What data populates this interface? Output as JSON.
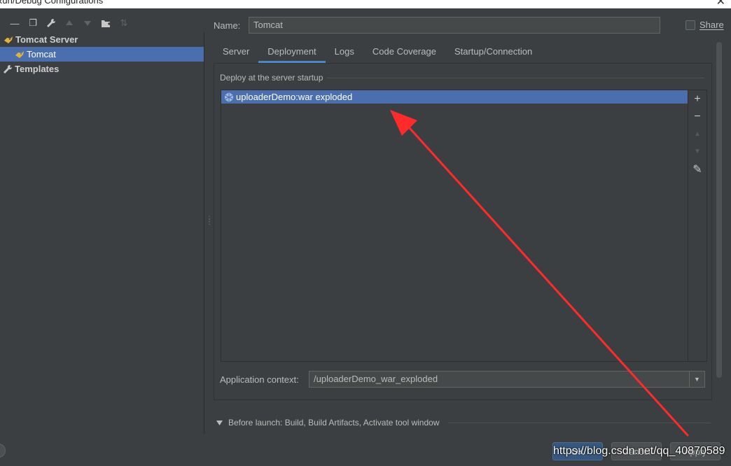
{
  "window": {
    "title": "Run/Debug Configurations",
    "close_glyph": "✕"
  },
  "toolbar": {
    "buttons": [
      {
        "name": "remove-icon",
        "glyph": "—",
        "enabled": true
      },
      {
        "name": "copy-icon",
        "glyph": "❐",
        "enabled": true
      },
      {
        "name": "wrench-icon",
        "glyph": "🔧",
        "enabled": true
      },
      {
        "name": "move-up-icon",
        "glyph": "▲",
        "enabled": false
      },
      {
        "name": "move-down-icon",
        "glyph": "▼",
        "enabled": false
      },
      {
        "name": "folder-add-icon",
        "glyph": "📁",
        "enabled": true
      },
      {
        "name": "sort-icon",
        "glyph": "⇅",
        "enabled": false
      }
    ]
  },
  "tree": {
    "items": [
      {
        "label": "Tomcat Server",
        "level": 0,
        "bold": true,
        "selected": false,
        "icon": "tomcat-icon"
      },
      {
        "label": "Tomcat",
        "level": 1,
        "bold": false,
        "selected": true,
        "icon": "tomcat-icon"
      },
      {
        "label": "Templates",
        "level": 0,
        "bold": true,
        "selected": false,
        "icon": "wrench-icon"
      }
    ]
  },
  "form": {
    "name_label": "Name:",
    "name_value": "Tomcat",
    "share_label": "Share",
    "share_checked": false
  },
  "tabs": [
    {
      "label": "Server",
      "active": false
    },
    {
      "label": "Deployment",
      "active": true
    },
    {
      "label": "Logs",
      "active": false
    },
    {
      "label": "Code Coverage",
      "active": false
    },
    {
      "label": "Startup/Connection",
      "active": false
    }
  ],
  "deployment": {
    "section_title": "Deploy at the server startup",
    "items": [
      {
        "label": "uploaderDemo:war exploded",
        "selected": true,
        "icon": "artifact-icon"
      }
    ],
    "side_buttons": [
      {
        "name": "add-icon",
        "glyph": "+",
        "enabled": true
      },
      {
        "name": "remove-icon",
        "glyph": "−",
        "enabled": true
      },
      {
        "name": "move-up-icon",
        "glyph": "▲",
        "enabled": false
      },
      {
        "name": "move-down-icon",
        "glyph": "▼",
        "enabled": false
      },
      {
        "name": "edit-icon",
        "glyph": "✎",
        "enabled": true
      }
    ],
    "context_label": "Application context:",
    "context_value": "/uploaderDemo_war_exploded",
    "context_arrow": "▼"
  },
  "before_launch": {
    "label": "Before launch: Build, Build Artifacts, Activate tool window"
  },
  "buttons": {
    "ok": "OK",
    "cancel": "Cancel",
    "apply": "Apply"
  },
  "watermark": "https://blog.csdn.net/qq_40870589",
  "colors": {
    "background": "#3c3f41",
    "selection": "#4b6eaf",
    "annotation_arrow": "#ff2a2a",
    "tab_underline": "#4a88c7"
  }
}
